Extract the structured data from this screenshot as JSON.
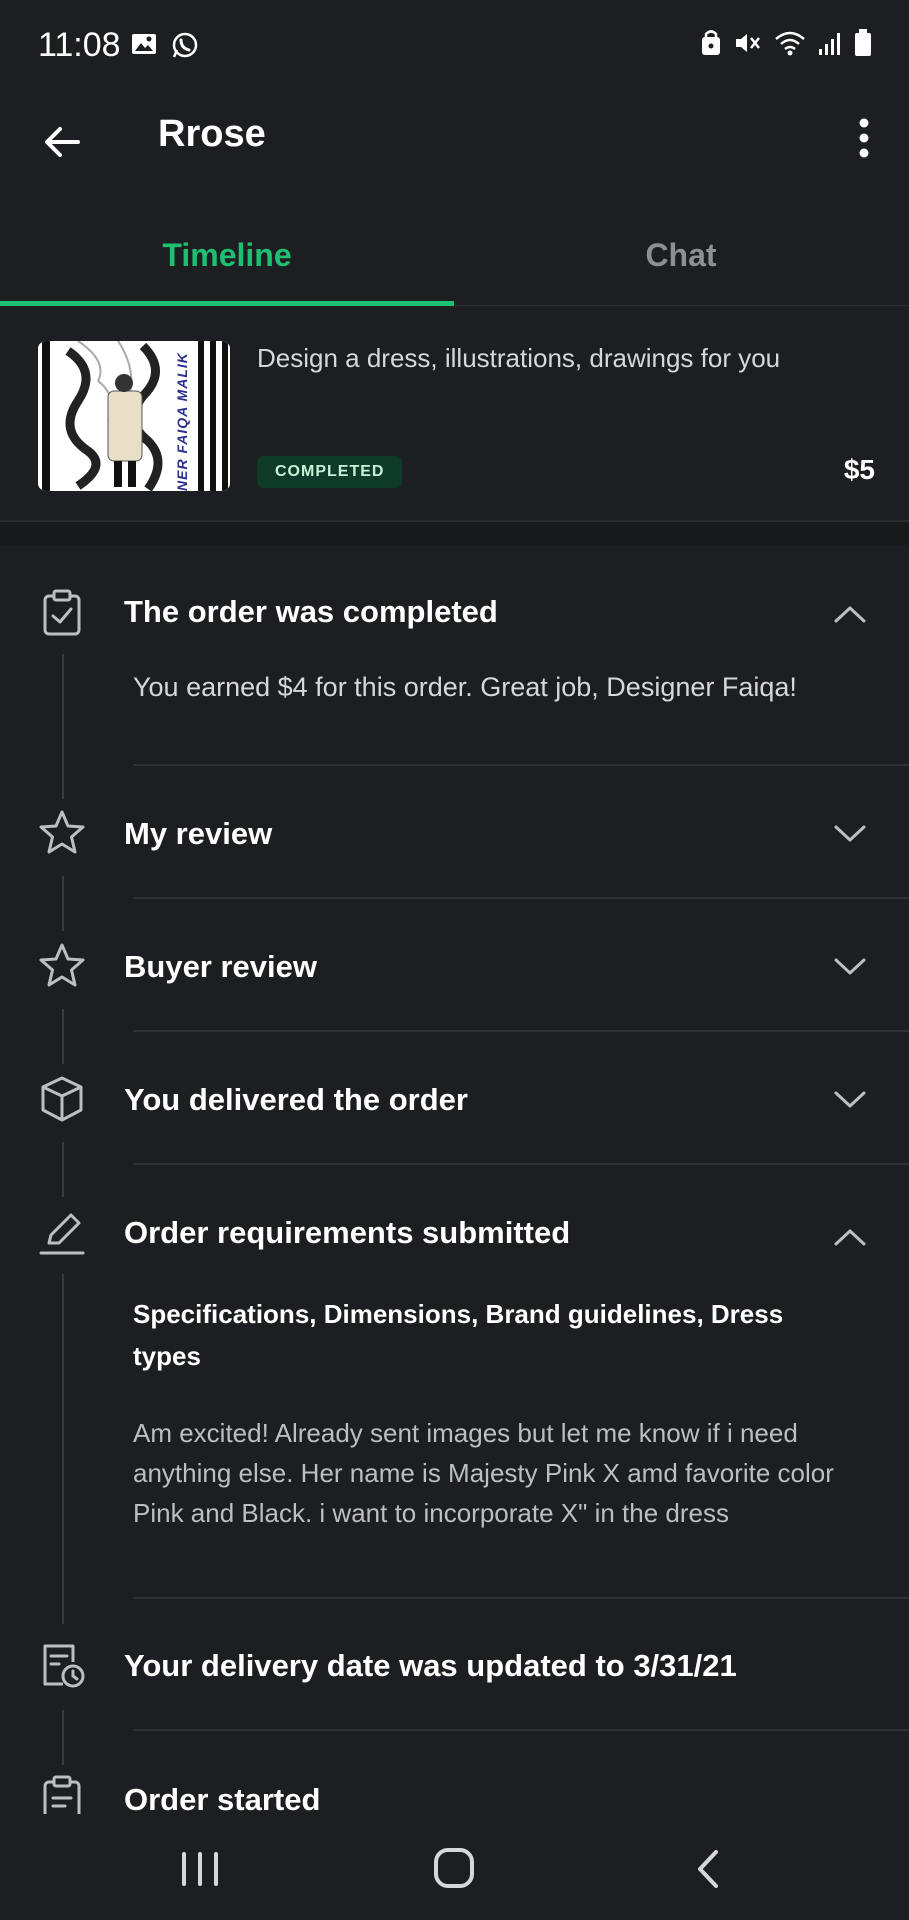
{
  "status_bar": {
    "time": "11:08"
  },
  "app_bar": {
    "title": "Rrose"
  },
  "tabs": [
    {
      "label": "Timeline",
      "active": true
    },
    {
      "label": "Chat",
      "active": false
    }
  ],
  "order": {
    "gig_title": "Design a dress, illustrations, drawings for you",
    "status_badge": "COMPLETED",
    "price": "$5",
    "thumbnail_text": "NER FAIQA MALIK"
  },
  "timeline": {
    "completed": {
      "title": "The order was completed",
      "body": "You earned $4 for this order. Great job, Designer Faiqa!"
    },
    "my_review": {
      "title": "My review"
    },
    "buyer_review": {
      "title": "Buyer review"
    },
    "delivered": {
      "title": "You delivered the order"
    },
    "requirements": {
      "title": "Order requirements submitted",
      "question": "Specifications, Dimensions, Brand guidelines, Dress types",
      "answer": "Am excited! Already sent images but let me know if i need anything else. Her name is Majesty Pink X amd favorite color Pink and Black. i want to incorporate X\" in the dress"
    },
    "delivery_date": {
      "title": "Your delivery date was updated to 3/31/21"
    },
    "started": {
      "title": "Order started"
    }
  },
  "colors": {
    "accent": "#1dbf73",
    "background": "#1d1e21",
    "badge_bg": "#0e3b27"
  }
}
